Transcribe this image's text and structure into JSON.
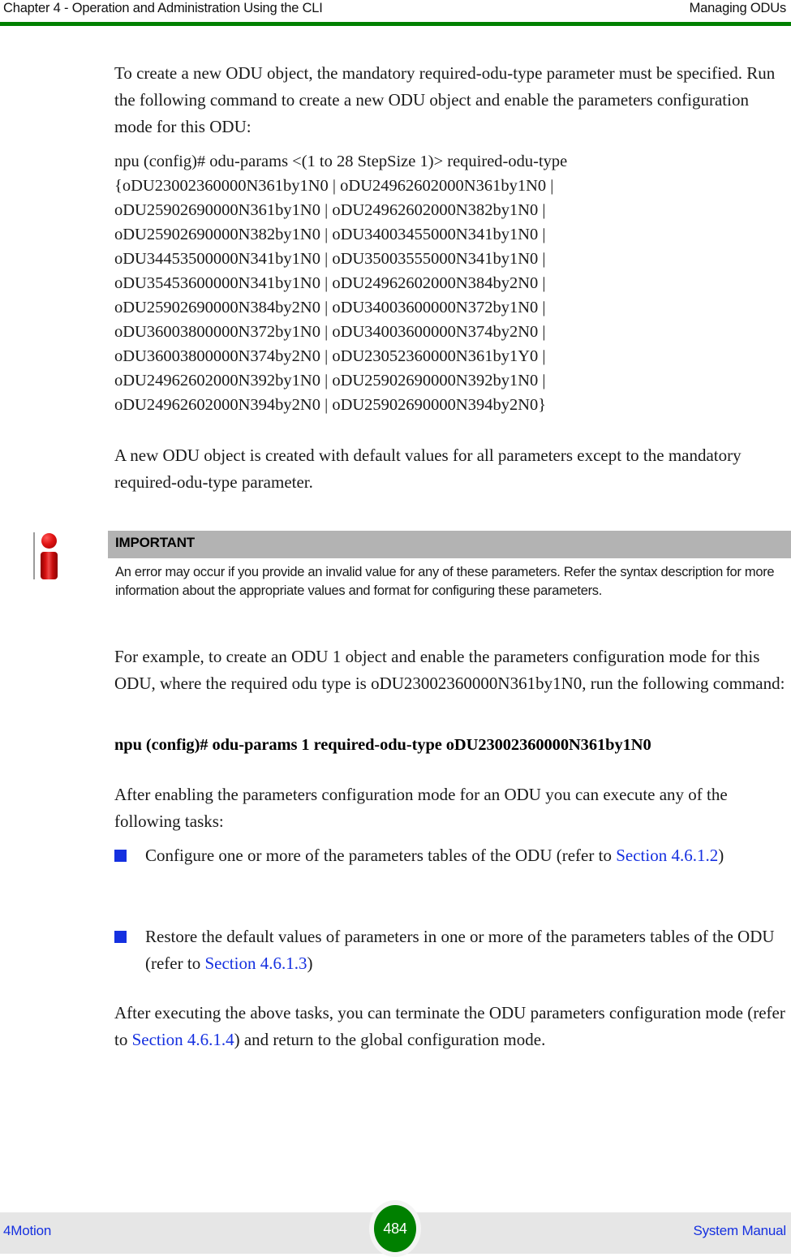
{
  "header": {
    "left": "Chapter 4 - Operation and Administration Using the CLI",
    "right": "Managing ODUs",
    "rule_color": "#008000"
  },
  "paragraphs": {
    "intro": "To create a new ODU object, the mandatory required-odu-type parameter must be specified. Run the following command to create a new ODU object and enable the parameters configuration mode for this ODU:",
    "after_command": "A new ODU object is created with default values for all parameters except to the mandatory required-odu-type parameter.",
    "example_lead": "For example, to create an ODU 1 object and enable the parameters configuration mode for this ODU, where the required odu type is oDU23002360000N361by1N0, run the following command:",
    "after_enabling": "After enabling the parameters configuration mode for an ODU you can execute any of the following tasks:"
  },
  "cli_command": {
    "lines": [
      "npu (config)# odu-params <(1 to 28 StepSize 1)> required-odu-type",
      "{oDU23002360000N361by1N0 | oDU24962602000N361by1N0 |",
      "oDU25902690000N361by1N0 | oDU24962602000N382by1N0 |",
      "oDU25902690000N382by1N0 | oDU34003455000N341by1N0 |",
      "oDU34453500000N341by1N0 | oDU35003555000N341by1N0 |",
      "oDU35453600000N341by1N0 | oDU24962602000N384by2N0 |",
      "oDU25902690000N384by2N0 | oDU34003600000N372by1N0 |",
      "oDU36003800000N372by1N0 | oDU34003600000N374by2N0 |",
      "oDU36003800000N374by2N0 | oDU23052360000N361by1Y0 |",
      "oDU24962602000N392by1N0 | oDU25902690000N392by1N0 |",
      "oDU24962602000N394by2N0 | oDU25902690000N394by2N0}"
    ]
  },
  "example_command": "npu (config)# odu-params 1 required-odu-type oDU23002360000N361by1N0",
  "note": {
    "icon": "info-important-icon",
    "title": "IMPORTANT",
    "body": "An error may occur if you provide an invalid value for any of these parameters. Refer the syntax description for more information about the appropriate values and format for configuring these parameters.",
    "title_bar_color": "#b3b3b3",
    "icon_color": "#cc0000"
  },
  "bullets": [
    {
      "text_before": "Configure one or more of the parameters tables of the ODU (refer to ",
      "link": "Section 4.6.1.2",
      "text_after": ")"
    },
    {
      "text_before": "Restore the default values of parameters in one or more of the parameters tables of the ODU (refer to ",
      "link": "Section 4.6.1.3",
      "text_after": ")"
    }
  ],
  "closing": {
    "text_before": "After executing the above tasks, you can terminate the ODU parameters configuration mode (refer to ",
    "link": "Section 4.6.1.4",
    "text_after": ") and return to the global configuration mode."
  },
  "link_color": "#1530e0",
  "footer": {
    "left": "4Motion",
    "page_number": "484",
    "right": "System Manual",
    "band_color": "#e6e6e6",
    "badge_color": "#008000"
  }
}
